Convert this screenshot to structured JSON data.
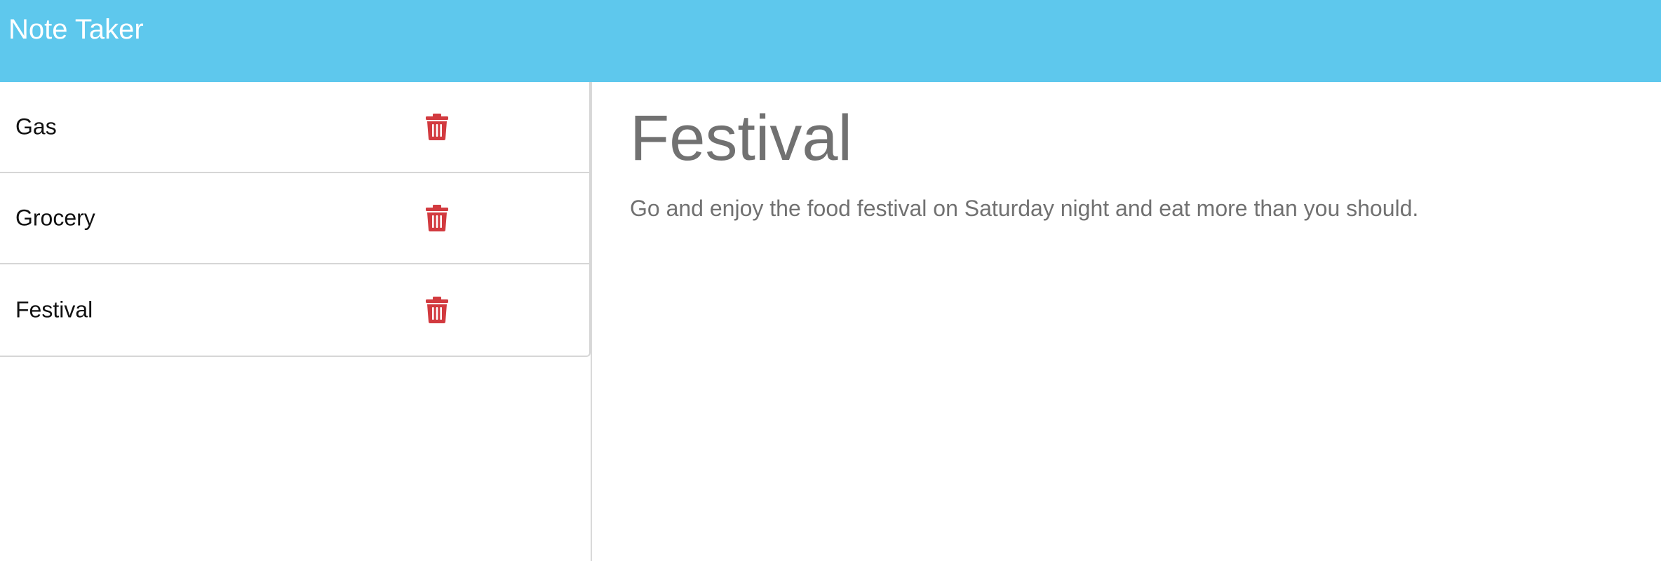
{
  "app": {
    "title": "Note Taker",
    "accent_color": "#5ec8ed",
    "delete_color": "#d23a3f"
  },
  "notes": [
    {
      "title": "Gas",
      "icon": "trash-icon"
    },
    {
      "title": "Grocery",
      "icon": "trash-icon"
    },
    {
      "title": "Festival",
      "icon": "trash-icon"
    }
  ],
  "active_note": {
    "title": "Festival",
    "text": "Go and enjoy the food festival on Saturday night and eat more than you should."
  }
}
